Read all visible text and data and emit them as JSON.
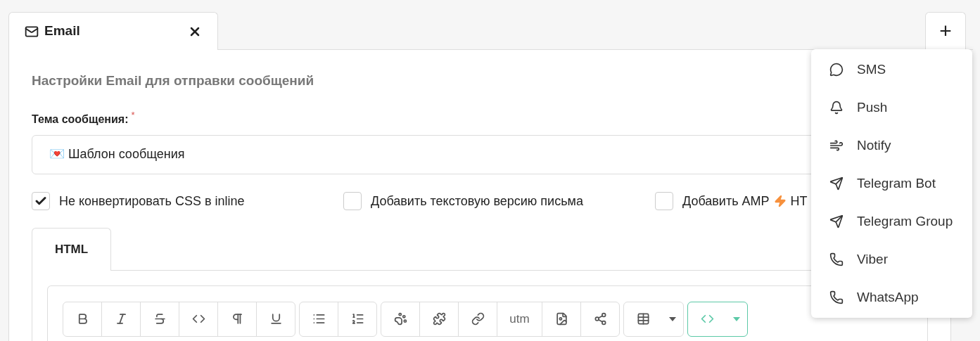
{
  "tabs": [
    {
      "label": "Email",
      "selected": true
    }
  ],
  "add_button": {
    "label": "+",
    "expanded": true
  },
  "menu": [
    {
      "label": "SMS"
    },
    {
      "label": "Push"
    },
    {
      "label": "Notify"
    },
    {
      "label": "Telegram Bot"
    },
    {
      "label": "Telegram Group"
    },
    {
      "label": "Viber"
    },
    {
      "label": "WhatsApp"
    }
  ],
  "heading": "Настройки Email для отправки сообщений",
  "subject": {
    "label": "Тема сообщения:",
    "required_mark": "*",
    "value": "💌 Шаблон сообщения"
  },
  "options": [
    {
      "label": "Не конвертировать CSS в inline",
      "checked": true
    },
    {
      "label": "Добавить текстовую версию письма",
      "checked": false
    },
    {
      "label": "Добавить AMP",
      "label_after": "HT",
      "checked": false
    }
  ],
  "editor_tabs": [
    {
      "label": "HTML",
      "selected": true
    }
  ],
  "toolbar": [
    [
      {
        "kind": "icon"
      },
      {
        "kind": "icon"
      },
      {
        "kind": "icon"
      },
      {
        "kind": "icon"
      },
      {
        "kind": "icon"
      },
      {
        "kind": "icon"
      }
    ],
    [
      {
        "kind": "icon"
      },
      {
        "kind": "icon"
      }
    ],
    [
      {
        "kind": "icon"
      },
      {
        "kind": "icon"
      },
      {
        "kind": "icon"
      },
      {
        "kind": "text",
        "label": "utm"
      },
      {
        "kind": "icon"
      },
      {
        "kind": "icon"
      }
    ],
    [
      {
        "kind": "icon"
      },
      {
        "kind": "caret"
      }
    ],
    [
      {
        "kind": "icon",
        "accent": true
      },
      {
        "kind": "caret",
        "accent": true
      }
    ]
  ]
}
